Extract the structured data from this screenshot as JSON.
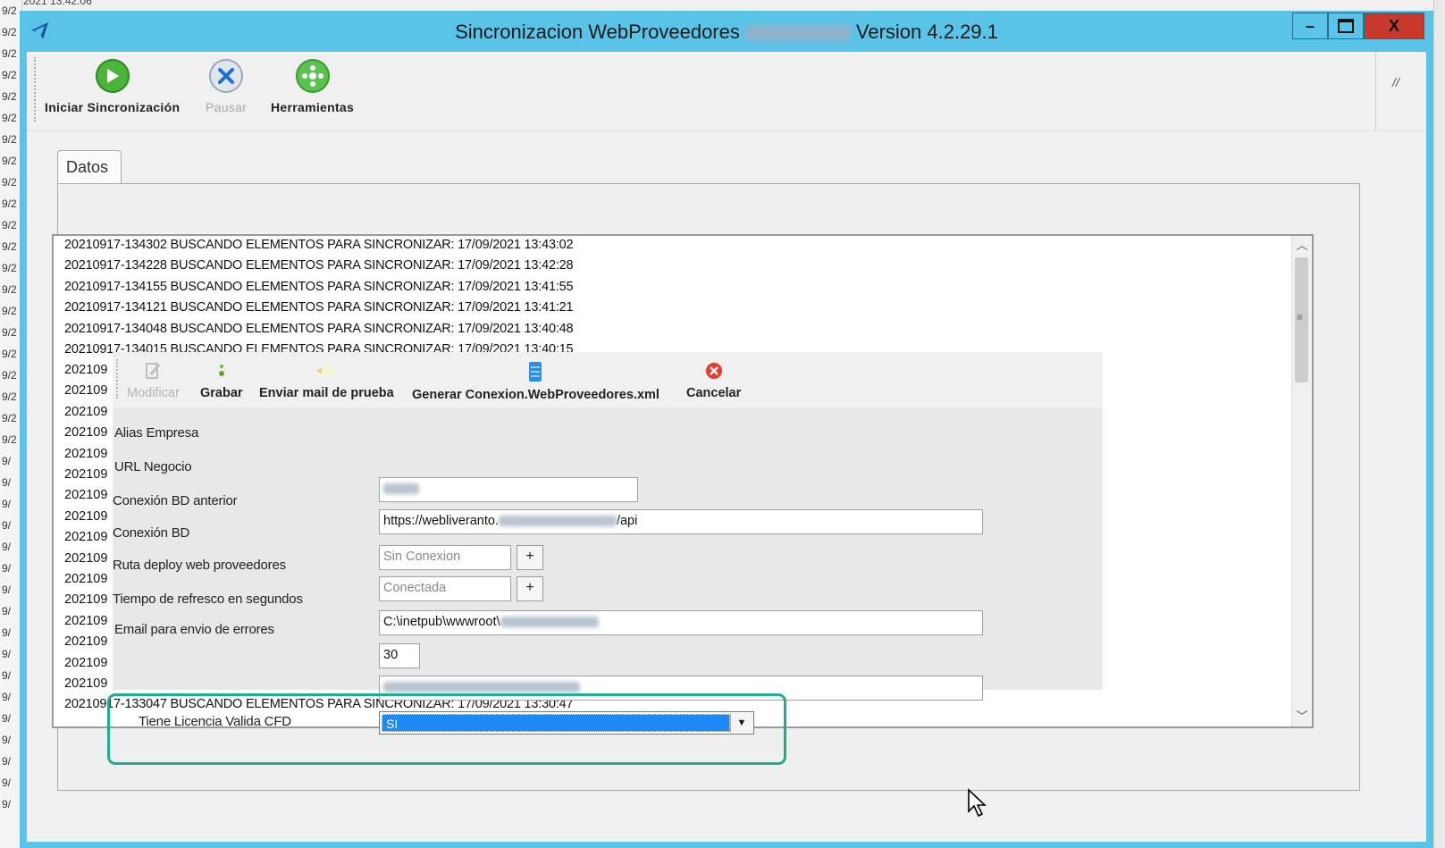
{
  "background": {
    "top_text": "2021 13:42:06",
    "left_fragments": [
      "9/2",
      "9/2",
      "9/2",
      "9/2",
      "9/2",
      "9/2",
      "9/2",
      "9/2",
      "9/2",
      "9/2",
      "9/2",
      "9/2",
      "9/2",
      "9/2",
      "9/2",
      "9/2",
      "9/2",
      "9/2",
      "9/2",
      "9/2",
      "9/2",
      "9/",
      "9/",
      "9/",
      "9/",
      "9/",
      "9/",
      "9/",
      "9/",
      "9/",
      "9/",
      "9/",
      "9/",
      "9/",
      "9/",
      "9/",
      "9/",
      "9/"
    ]
  },
  "window": {
    "title_prefix": "Sincronizacion WebProveedores",
    "title_suffix": "Version 4.2.29.1",
    "minimize_glyph": "–",
    "close_glyph": "X"
  },
  "toolbar": {
    "start_label": "Iniciar Sincronización",
    "pause_label": "Pausar",
    "tools_label": "Herramientas",
    "overflow_glyph": "//"
  },
  "tab": {
    "label": "Datos"
  },
  "log": {
    "lines": [
      "20210917-134302 BUSCANDO ELEMENTOS PARA SINCRONIZAR: 17/09/2021 13:43:02",
      "20210917-134228 BUSCANDO ELEMENTOS PARA SINCRONIZAR: 17/09/2021 13:42:28",
      "20210917-134155 BUSCANDO ELEMENTOS PARA SINCRONIZAR: 17/09/2021 13:41:55",
      "20210917-134121 BUSCANDO ELEMENTOS PARA SINCRONIZAR: 17/09/2021 13:41:21",
      "20210917-134048 BUSCANDO ELEMENTOS PARA SINCRONIZAR: 17/09/2021 13:40:48",
      "20210917-134015 BUSCANDO ELEMENTOS PARA SINCRONIZAR: 17/09/2021 13:40:15"
    ],
    "stub": "202109",
    "last_line": "20210917-133047 BUSCANDO ELEMENTOS PARA SINCRONIZAR: 17/09/2021 13:30:47"
  },
  "form": {
    "toolbar": {
      "modify_label": "Modificar",
      "save_label": "Grabar",
      "mail_label": "Enviar mail de prueba",
      "generate_label": "Generar Conexion.WebProveedores.xml",
      "cancel_label": "Cancelar"
    },
    "fields": {
      "alias_label": "Alias Empresa",
      "url_label": "URL Negocio",
      "url_prefix": "https://webliveranto.",
      "url_suffix": "/api",
      "prev_db_label": "Conexión BD anterior",
      "prev_db_value": "Sin Conexion",
      "db_label": "Conexión BD",
      "db_value": "Conectada",
      "deploy_label": "Ruta deploy web proveedores",
      "deploy_value": "C:\\inetpub\\wwwroot\\",
      "refresh_label": "Tiempo de refresco en segundos",
      "refresh_value": "30",
      "email_label": "Email para envio de errores",
      "license_label": "Tiene Licencia Valida CFD",
      "license_value": "SI",
      "plus_glyph": "+"
    }
  },
  "colors": {
    "titlebar": "#5ac4e8",
    "close_button": "#c8392b",
    "selection": "#1e88f5",
    "highlight": "#1fae8d"
  }
}
